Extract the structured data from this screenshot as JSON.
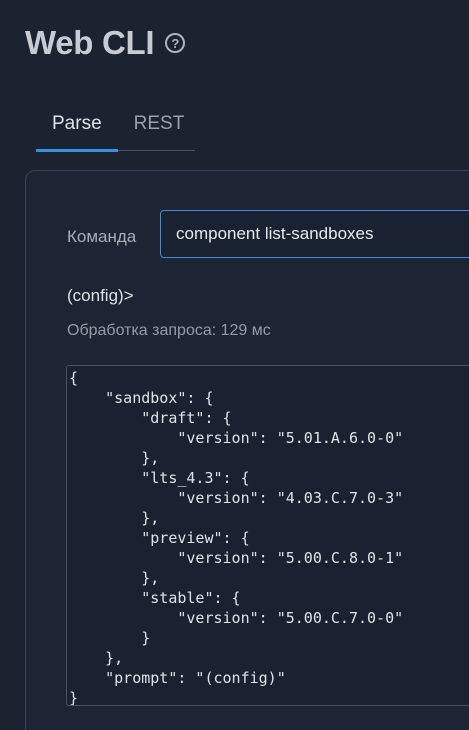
{
  "header": {
    "title": "Web CLI",
    "help_icon": "help-circle-icon"
  },
  "tabs": [
    {
      "label": "Parse",
      "active": true
    },
    {
      "label": "REST",
      "active": false
    }
  ],
  "command": {
    "label": "Команда",
    "value": "component list-sandboxes"
  },
  "prompt": "(config)>",
  "timing": "Обработка запроса: 129 мс",
  "output": {
    "json": "{\n    \"sandbox\": {\n        \"draft\": {\n            \"version\": \"5.01.A.6.0-0\"\n        },\n        \"lts_4.3\": {\n            \"version\": \"4.03.C.7.0-3\"\n        },\n        \"preview\": {\n            \"version\": \"5.00.C.8.0-1\"\n        },\n        \"stable\": {\n            \"version\": \"5.00.C.7.0-0\"\n        }\n    },\n    \"prompt\": \"(config)\"\n}"
  },
  "colors": {
    "background": "#1b2230",
    "accent": "#3a8fe0",
    "border": "#4a5160"
  }
}
